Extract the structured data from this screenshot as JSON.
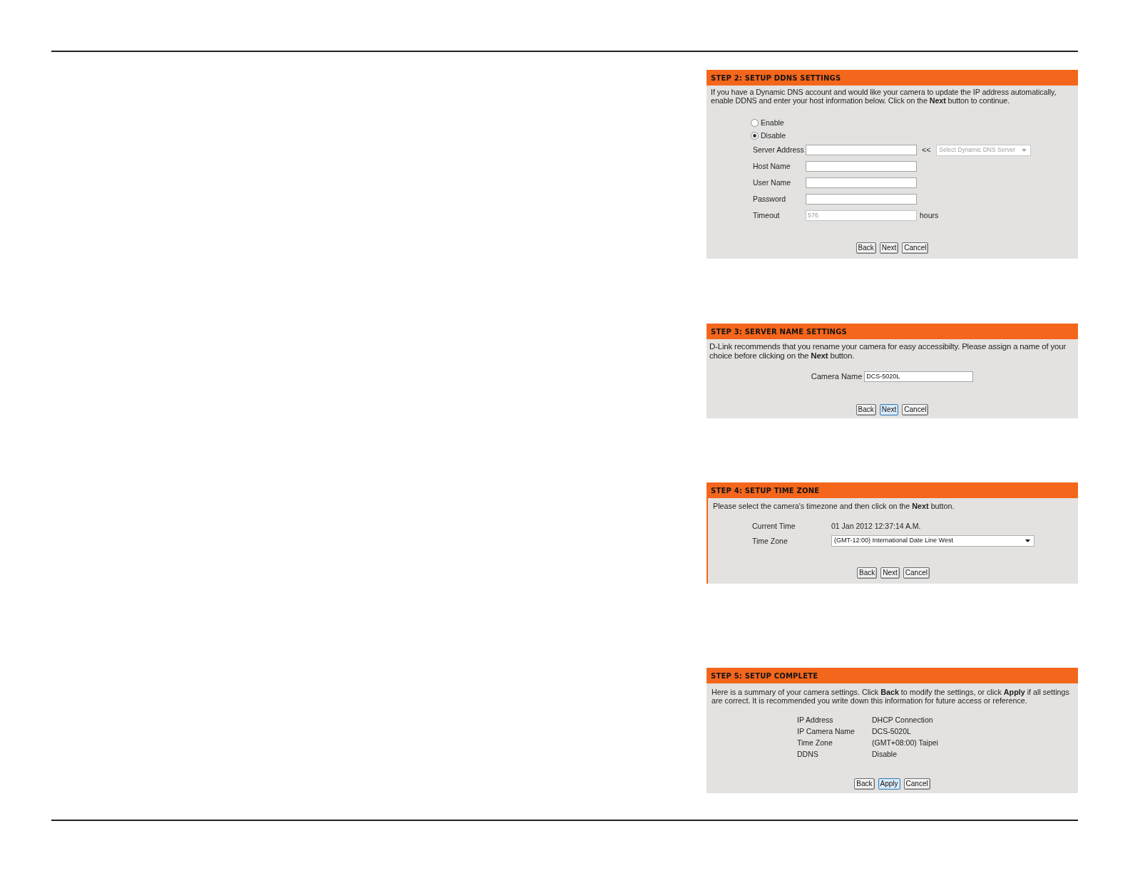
{
  "steps": [
    {
      "kind": "ddns",
      "title": "STEP 2: SETUP DDNS SETTINGS",
      "description": "If you have a Dynamic DNS account and would like your camera to update the IP address automatically, enable DDNS and enter your host information below. Click on the **Next** button to continue.",
      "options": [
        {
          "label": "Enable",
          "selected": false
        },
        {
          "label": "Disable",
          "selected": true
        }
      ],
      "fields": [
        {
          "label": "Server Address",
          "disabled": false,
          "separator": "<<",
          "server_select": {
            "value": "Select Dynamic DNS Server",
            "disabled": true
          }
        },
        {
          "label": "Host Name",
          "disabled": false
        },
        {
          "label": "User Name",
          "disabled": false
        },
        {
          "label": "Password",
          "disabled": false
        },
        {
          "label": "Timeout",
          "value": "576",
          "disabled": true,
          "unit": "hours"
        }
      ],
      "buttons": [
        {
          "label": "Back",
          "highlighted": false
        },
        {
          "label": "Next",
          "highlighted": false
        },
        {
          "label": "Cancel",
          "highlighted": false
        }
      ]
    },
    {
      "kind": "name",
      "title": "STEP 3: SERVER NAME SETTINGS",
      "description": "D-Link recommends that you rename your camera for easy accessibilty. Please assign a name of your choice before clicking on the **Next** button.",
      "field": {
        "label": "Camera Name",
        "value": "DCS-5020L"
      },
      "buttons": [
        {
          "label": "Back",
          "highlighted": false
        },
        {
          "label": "Next",
          "highlighted": true
        },
        {
          "label": "Cancel",
          "highlighted": false
        }
      ]
    },
    {
      "kind": "timezone",
      "title": "STEP 4: SETUP TIME ZONE",
      "description": "Please select the camera's timezone and then click on the **Next** button.",
      "rows": [
        {
          "kind": "text",
          "label": "Current Time",
          "value": "01 Jan 2012 12:37:14 A.M."
        },
        {
          "kind": "select",
          "label": "Time Zone",
          "value": "(GMT-12:00) International Date Line West"
        }
      ],
      "buttons": [
        {
          "label": "Back",
          "highlighted": false
        },
        {
          "label": "Next",
          "highlighted": false
        },
        {
          "label": "Cancel",
          "highlighted": false
        }
      ]
    },
    {
      "kind": "summary",
      "title": "STEP 5: SETUP COMPLETE",
      "description": "Here is a summary of your camera settings. Click **Back** to modify the settings, or click **Apply** if all settings are correct. It is recommended you write down this information for future access or reference.",
      "rows": [
        {
          "label": "IP Address",
          "value": "DHCP Connection"
        },
        {
          "label": "IP Camera Name",
          "value": "DCS-5020L"
        },
        {
          "label": "Time Zone",
          "value": "(GMT+08:00) Taipei"
        },
        {
          "label": "DDNS",
          "value": "Disable"
        }
      ],
      "buttons": [
        {
          "label": "Back",
          "highlighted": false
        },
        {
          "label": "Apply",
          "highlighted": true
        },
        {
          "label": "Cancel",
          "highlighted": false
        }
      ]
    }
  ]
}
